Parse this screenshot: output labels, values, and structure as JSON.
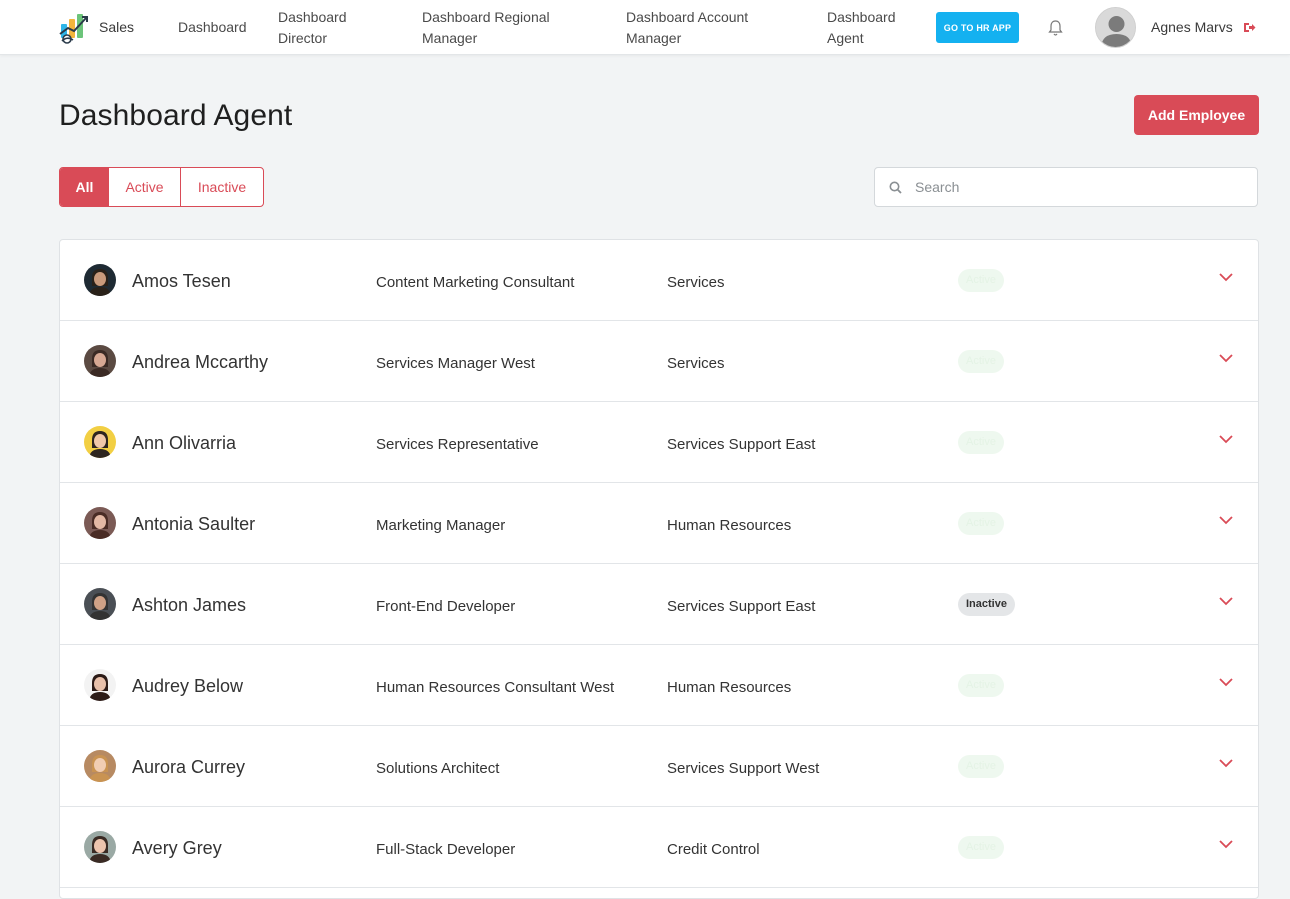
{
  "brand": {
    "name": "Sales",
    "logo_icon": "sales-logo-icon"
  },
  "nav": {
    "links": [
      {
        "label": "Dashboard"
      },
      {
        "label": "Dashboard Director"
      },
      {
        "label": "Dashboard Regional Manager"
      },
      {
        "label": "Dashboard Account Manager"
      },
      {
        "label": "Dashboard Agent"
      }
    ],
    "hr_button": "GO TO HR APP",
    "user_name": "Agnes Marvs"
  },
  "page": {
    "title": "Dashboard Agent",
    "add_button": "Add Employee"
  },
  "filters": {
    "all": "All",
    "active": "Active",
    "inactive": "Inactive",
    "selected": "All"
  },
  "search": {
    "placeholder": "Search",
    "value": ""
  },
  "colors": {
    "accent": "#d94b57",
    "hr_button": "#14b1f0",
    "active_badge_bg": "#eef8ef",
    "inactive_badge_bg": "#e4e6e8"
  },
  "employees": [
    {
      "name": "Amos Tesen",
      "role": "Content Marketing Consultant",
      "department": "Services",
      "status": "Active"
    },
    {
      "name": "Andrea Mccarthy",
      "role": "Services Manager West",
      "department": "Services",
      "status": "Active"
    },
    {
      "name": "Ann Olivarria",
      "role": "Services Representative",
      "department": "Services Support East",
      "status": "Active"
    },
    {
      "name": "Antonia Saulter",
      "role": "Marketing Manager",
      "department": "Human Resources",
      "status": "Active"
    },
    {
      "name": "Ashton James",
      "role": "Front-End Developer",
      "department": "Services Support East",
      "status": "Inactive"
    },
    {
      "name": "Audrey Below",
      "role": "Human Resources Consultant West",
      "department": "Human Resources",
      "status": "Active"
    },
    {
      "name": "Aurora Currey",
      "role": "Solutions Architect",
      "department": "Services Support West",
      "status": "Active"
    },
    {
      "name": "Avery Grey",
      "role": "Full-Stack Developer",
      "department": "Credit Control",
      "status": "Active"
    }
  ]
}
